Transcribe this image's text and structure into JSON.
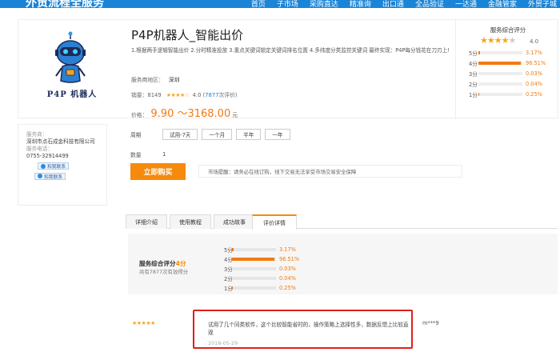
{
  "topnav": {
    "brand": "外贸流程全服务",
    "items": [
      "首页",
      "子市场",
      "采购直达",
      "精准询",
      "出口通",
      "全品验证",
      "一达通",
      "金融管家",
      "外贸子城"
    ]
  },
  "product": {
    "logo_text": "P4P 机器人",
    "title": "P4P机器人_智能出价",
    "desc": "1.根据两手逻辑智能出价 2.分时精准投放 3.重点关键词锁定关键词排名位置 4.多纬度分类监控关键词 最终实现：P4P每分钱花在刀刃上!",
    "region_label": "服务商地区：",
    "region": "深圳",
    "sales_label": "销量：",
    "sales": "8149",
    "stars": "★★★★☆",
    "score": "4.0",
    "reviews_open": "(",
    "reviews_count": "7877",
    "reviews_suffix": "次评价)",
    "price_label": "价格：",
    "price_range": "9.90 ～3168.00",
    "price_unit": "元"
  },
  "rating_side": {
    "title": "服务综合评分",
    "stars_filled": "★★★★",
    "stars_empty": "★",
    "score": "4.0",
    "rows": [
      {
        "label": "5分",
        "pct": "3.17%",
        "value": 3.17
      },
      {
        "label": "4分",
        "pct": "96.51%",
        "value": 96.51
      },
      {
        "label": "3分",
        "pct": "0.03%",
        "value": 0.03
      },
      {
        "label": "2分",
        "pct": "0.04%",
        "value": 0.04
      },
      {
        "label": "1分",
        "pct": "0.25%",
        "value": 0.25
      }
    ]
  },
  "seller": {
    "provider_label": "服务商：",
    "provider": "深圳市点石成金科技有限公司",
    "phone_label": "服务电话：",
    "phone": "0755-32914499",
    "contact1": "和我联系",
    "contact2": "和我联系"
  },
  "order": {
    "period_label": "周期",
    "periods": [
      "试用-7天",
      "一个月",
      "半年",
      "一年"
    ],
    "qty_label": "数量",
    "qty": "1",
    "buy": "立即购买",
    "notice": "市场提醒：请务必在线订购，线下交易无法享受市场交易安全保障"
  },
  "tabs": [
    "详细介绍",
    "使用教程",
    "成功故事",
    "评价详情"
  ],
  "summary": {
    "title_prefix": "服务综合评分",
    "title_score": "4分",
    "subtitle": "共有7877次有效得分",
    "rows": [
      {
        "label": "5分",
        "pct": "3.17%",
        "value": 3.17
      },
      {
        "label": "4分",
        "pct": "96.51%",
        "value": 96.51
      },
      {
        "label": "3分",
        "pct": "0.03%",
        "value": 0.03
      },
      {
        "label": "2分",
        "pct": "0.04%",
        "value": 0.04
      },
      {
        "label": "1分",
        "pct": "0.25%",
        "value": 0.25
      }
    ]
  },
  "review": {
    "stars": "★★★★★",
    "text": "试用了几个同类软件，这个比较智能省时的，操作策略上选择性多，数据反馈上比较直观",
    "date": "2018-05-29",
    "user": "m***9"
  }
}
